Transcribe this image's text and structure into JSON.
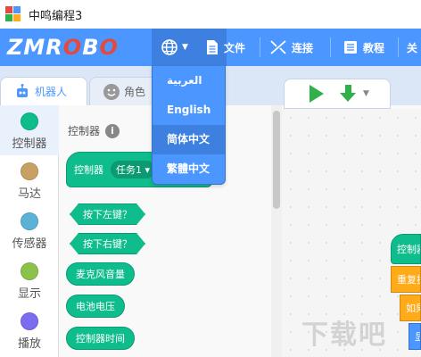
{
  "window": {
    "title": "中鸣编程3"
  },
  "menubar": {
    "logo": "ZMROBO",
    "file_label": "文件",
    "connect_label": "连接",
    "tutorial_label": "教程",
    "extra_label": "关"
  },
  "language_menu": {
    "options": [
      "العربية",
      "English",
      "简体中文",
      "繁體中文"
    ],
    "selected": "简体中文"
  },
  "tabs": [
    {
      "label": "机器人",
      "active": true
    },
    {
      "label": "角色",
      "active": false
    }
  ],
  "categories": [
    {
      "label": "控制器",
      "color": "#0fbd8c"
    },
    {
      "label": "马达",
      "color": "#c9a064"
    },
    {
      "label": "传感器",
      "color": "#5cb1d6"
    },
    {
      "label": "显示",
      "color": "#8bc34a"
    },
    {
      "label": "播放",
      "color": "#7c6cf0"
    }
  ],
  "palette": {
    "title": "控制器",
    "hat_block": {
      "label": "控制器",
      "dropdown": "任务1 ▾"
    },
    "blocks": [
      "按下左键？",
      "按下右键？",
      "麦克风音量",
      "电池电压",
      "控制器时间"
    ]
  },
  "workspace": {
    "hat_label": "控制器",
    "repeat_label": "重复执行",
    "if_label": "如果",
    "inner_label": "显示"
  },
  "watermark": "下载吧",
  "colors": {
    "accent": "#4c97ff",
    "controller": "#0fbd8c",
    "control_flow": "#ffab19"
  }
}
